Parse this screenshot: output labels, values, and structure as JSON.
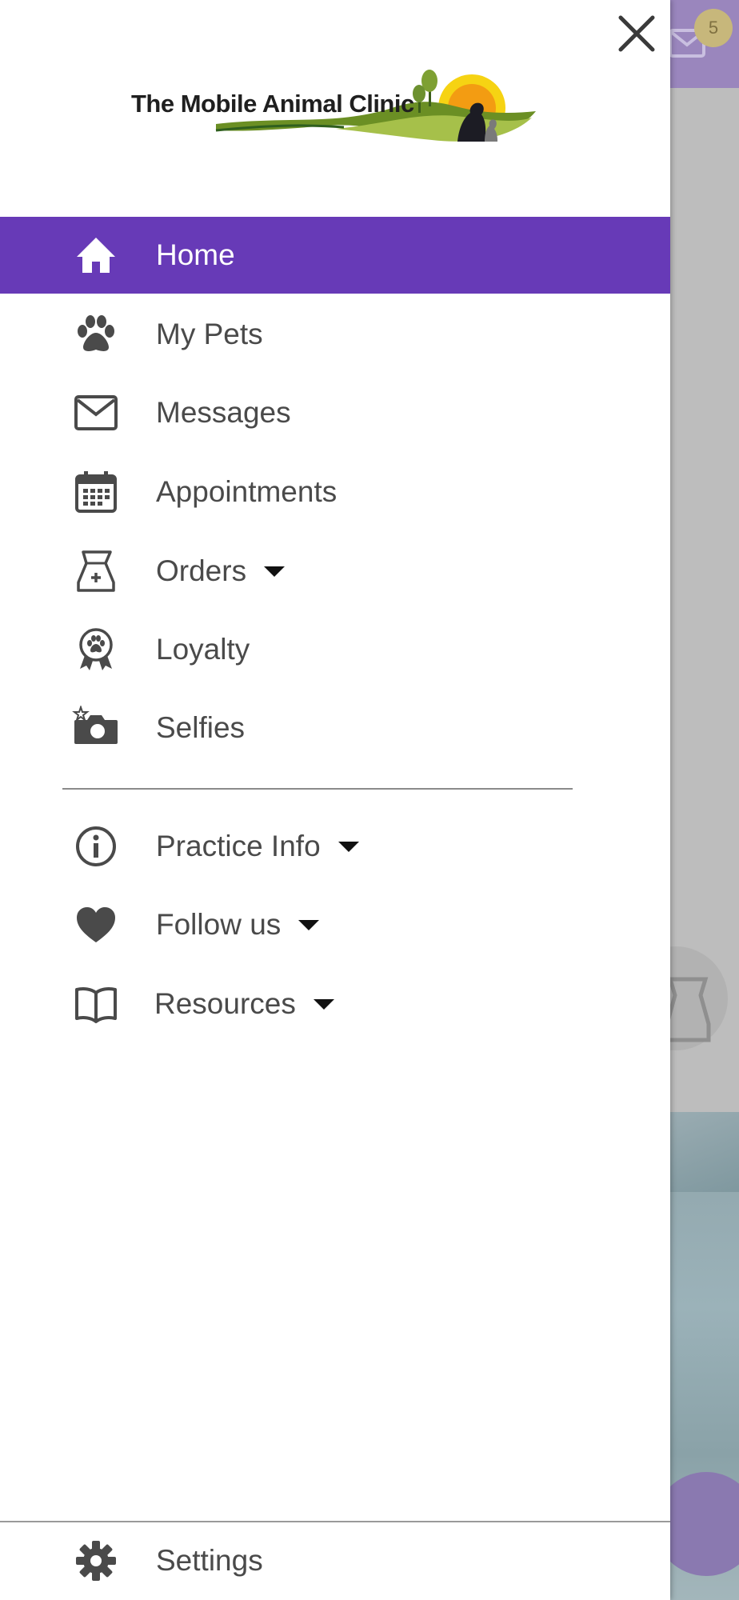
{
  "background": {
    "unread_badge": "5"
  },
  "drawer": {
    "brand": "The Mobile Animal Clinic",
    "menu": [
      {
        "label": "Home",
        "icon": "home-icon",
        "active": true
      },
      {
        "label": "My Pets",
        "icon": "paw-icon"
      },
      {
        "label": "Messages",
        "icon": "envelope-icon"
      },
      {
        "label": "Appointments",
        "icon": "calendar-icon"
      },
      {
        "label": "Orders",
        "icon": "food-bag-icon",
        "expandable": true
      },
      {
        "label": "Loyalty",
        "icon": "award-ribbon-icon"
      },
      {
        "label": "Selfies",
        "icon": "camera-icon"
      }
    ],
    "secondary_menu": [
      {
        "label": "Practice Info",
        "icon": "info-icon",
        "expandable": true
      },
      {
        "label": "Follow us",
        "icon": "heart-icon",
        "expandable": true
      },
      {
        "label": "Resources",
        "icon": "book-icon",
        "expandable": true
      }
    ],
    "settings": {
      "label": "Settings",
      "icon": "gear-icon"
    }
  },
  "colors": {
    "accent": "#673ab7",
    "text": "#4a4a4a",
    "icon": "#4a4a4a"
  }
}
